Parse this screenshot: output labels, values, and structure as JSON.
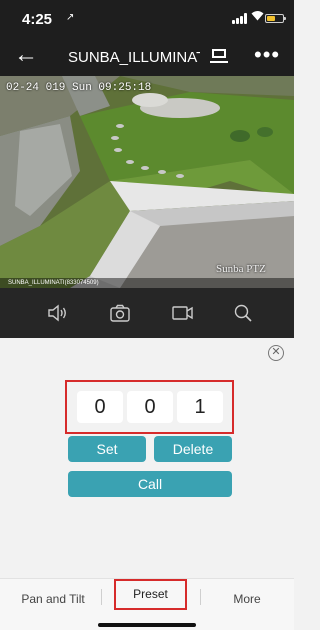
{
  "status_bar": {
    "time": "4:25",
    "location_glyph": "↗"
  },
  "nav": {
    "back_glyph": "←",
    "title": "SUNBA_ILLUMINAT...",
    "more_glyph": "•••"
  },
  "video": {
    "osd_time": "02-24 019 Sun 09:25:18",
    "watermark": "Sunba PTZ",
    "caption": "SUNBA_ILLUMINATI(833074509)"
  },
  "controls": {
    "icons": [
      "speaker-icon",
      "camera-icon",
      "video-record-icon",
      "search-icon"
    ]
  },
  "preset_panel": {
    "close_glyph": "✕",
    "digits": [
      "0",
      "0",
      "1"
    ],
    "set_label": "Set",
    "delete_label": "Delete",
    "call_label": "Call"
  },
  "tabs": {
    "pan_tilt": "Pan and Tilt",
    "preset": "Preset",
    "more": "More",
    "selected": "Preset"
  },
  "colors": {
    "accent": "#3aa2b2",
    "highlight_box": "#d62b2b",
    "battery": "#f2c12e"
  }
}
